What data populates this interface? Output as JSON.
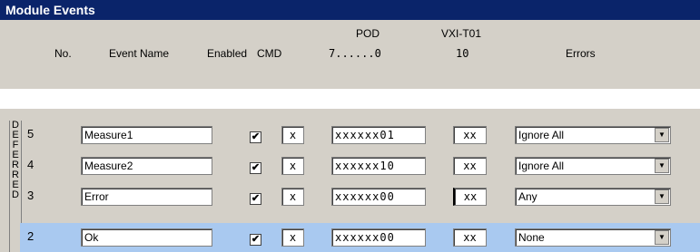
{
  "title": "Module Events",
  "headers": {
    "no": "No.",
    "event_name": "Event Name",
    "enabled": "Enabled",
    "cmd": "CMD",
    "pod": "POD",
    "pod_bits": "7......0",
    "vxi": "VXI-T01",
    "vxi_sub": "10",
    "errors": "Errors"
  },
  "side_letters": [
    "D",
    "E",
    "F",
    "E",
    "R",
    "R",
    "E",
    "D"
  ],
  "events": [
    {
      "no": "5",
      "name": "Measure1",
      "enabled": "✔",
      "cmd": "x",
      "pod": "xxxxxx01",
      "vxi": "xx",
      "error": "Ignore All"
    },
    {
      "no": "4",
      "name": "Measure2",
      "enabled": "✔",
      "cmd": "x",
      "pod": "xxxxxx10",
      "vxi": "xx",
      "error": "Ignore All"
    },
    {
      "no": "3",
      "name": "Error",
      "enabled": "✔",
      "cmd": "x",
      "pod": "xxxxxx00",
      "vxi": "xx",
      "error": "Any"
    },
    {
      "no": "2",
      "name": "Ok",
      "enabled": "✔",
      "cmd": "x",
      "pod": "xxxxxx00",
      "vxi": "xx",
      "error": "None"
    }
  ],
  "icons": {
    "dropdown": "chevron-down-icon"
  }
}
